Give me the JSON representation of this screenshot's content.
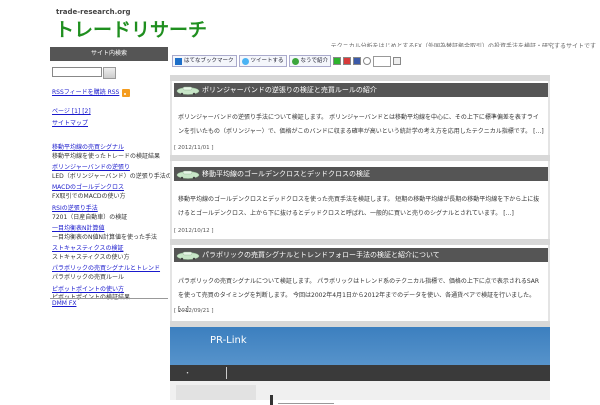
{
  "header": {
    "site_url": "trade-research.org",
    "logo": "トレードリサーチ",
    "tagline": "テクニカル分析をはじめとするFX（外国為替証拠金取引）の投資手法を検証・研究するサイトです"
  },
  "sidebar": {
    "heading": "サイト内検索",
    "search_placeholder": "",
    "rss_label": "RSSフィードを購読 RSS",
    "pages": "ページ [1] [2]",
    "sitemap": "サイトマップ",
    "items": [
      {
        "link": "移動平均線の売買シグナル",
        "desc": "移動平均線を使ったトレードの検証結果"
      },
      {
        "link": "ボリンジャーバンドの逆張り",
        "desc": "LED（ボリンジャーバンド）の逆張り手法の検証"
      },
      {
        "link": "MACDのゴールデンクロス",
        "desc": "FX取引でのMACDの使い方"
      },
      {
        "link": "RSIの逆張り手法",
        "desc": "7201（日産自動車）の検証"
      },
      {
        "link": "一目均衡表N計算値",
        "desc": "一目均衡表のN値N計算値を使った手法"
      },
      {
        "link": "ストキャスティクスの検証",
        "desc": "ストキャスティクスの使い方"
      },
      {
        "link": "パラボリックの売買シグナルとトレンド",
        "desc": "パラボリックの売買ルール"
      },
      {
        "link": "ピボットポイントの使い方",
        "desc": "ピボットポイントの検証結果"
      }
    ],
    "footer_link": "DMM FX"
  },
  "share": {
    "hatena": "はてなブックマーク",
    "tweet": "ツイートする",
    "naru": "なうで紹介"
  },
  "posts": [
    {
      "title": "ボリンジャーバンドの逆張りの検証と売買ルールの紹介",
      "excerpt": "ボリンジャーバンドの逆張り手法について検証します。 ボリンジャーバンドとは移動平均線を中心に、その上下に標準偏差を表すラインを引いたもの（ボリンジャー）で、価格がこのバンドに収まる確率が高いという統計学の考え方を応用したテクニカル指標です。 […]",
      "date": "[ 2012/11/01 ]"
    },
    {
      "title": "移動平均線のゴールデンクロスとデッドクロスの検証",
      "excerpt": "移動平均線のゴールデンクロスとデッドクロスを使った売買手法を検証します。 短期の移動平均線が長期の移動平均線を下から上に抜けるとゴールデンクロス、上から下に抜けるとデッドクロスと呼ばれ、一般的に買いと売りのシグナルとされています。 […]",
      "date": "[ 2012/10/12 ]"
    },
    {
      "title": "パラボリックの売買シグナルとトレンドフォロー手法の検証と紹介について",
      "excerpt": "パラボリックの売買シグナルについて検証します。 パラボリックはトレンド系のテクニカル指標で、価格の上下に点で表示されるSARを使って売買のタイミングを判断します。 今回は2002年4月1日から2012年までのデータを使い、各通貨ペアで検証を行いました。 […]",
      "date": "[ 2012/09/21 ]"
    }
  ],
  "pr": {
    "title": "PR-Link",
    "dot": "・",
    "box_text": "I"
  }
}
